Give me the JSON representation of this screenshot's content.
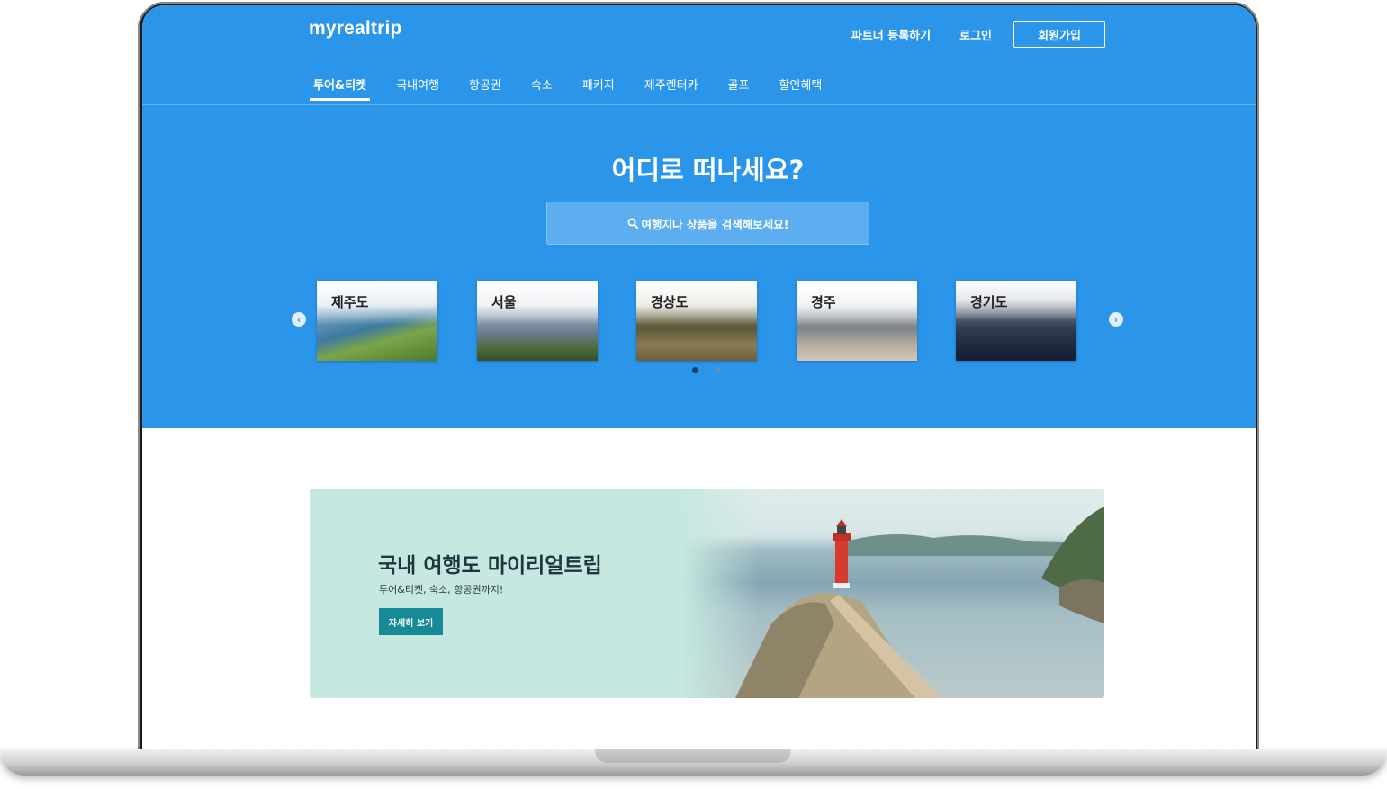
{
  "header": {
    "logo": "myrealtrip",
    "links": {
      "partner": "파트너 등록하기",
      "login": "로그인",
      "signup": "회원가입"
    }
  },
  "nav": {
    "items": [
      {
        "label": "투어&티켓",
        "active": true
      },
      {
        "label": "국내여행",
        "active": false
      },
      {
        "label": "항공권",
        "active": false
      },
      {
        "label": "숙소",
        "active": false
      },
      {
        "label": "패키지",
        "active": false
      },
      {
        "label": "제주렌터카",
        "active": false
      },
      {
        "label": "골프",
        "active": false
      },
      {
        "label": "할인혜택",
        "active": false
      }
    ]
  },
  "hero": {
    "title": "어디로 떠나세요?",
    "search_placeholder": "여행지나 상품을 검색해보세요!"
  },
  "destinations": [
    {
      "label": "제주도"
    },
    {
      "label": "서울"
    },
    {
      "label": "경상도"
    },
    {
      "label": "경주"
    },
    {
      "label": "경기도"
    }
  ],
  "carousel": {
    "left_icon": "chevron-left-icon",
    "right_icon": "chevron-right-icon",
    "pages": 2,
    "active_page": 1
  },
  "banner": {
    "title": "국내 여행도 마이리얼트립",
    "subtitle": "투어&티켓, 숙소, 항공권까지!",
    "button": "자세히 보기"
  },
  "colors": {
    "primary": "#2b95ea",
    "banner_bg": "#c6e8e0",
    "banner_button": "#168a96"
  }
}
